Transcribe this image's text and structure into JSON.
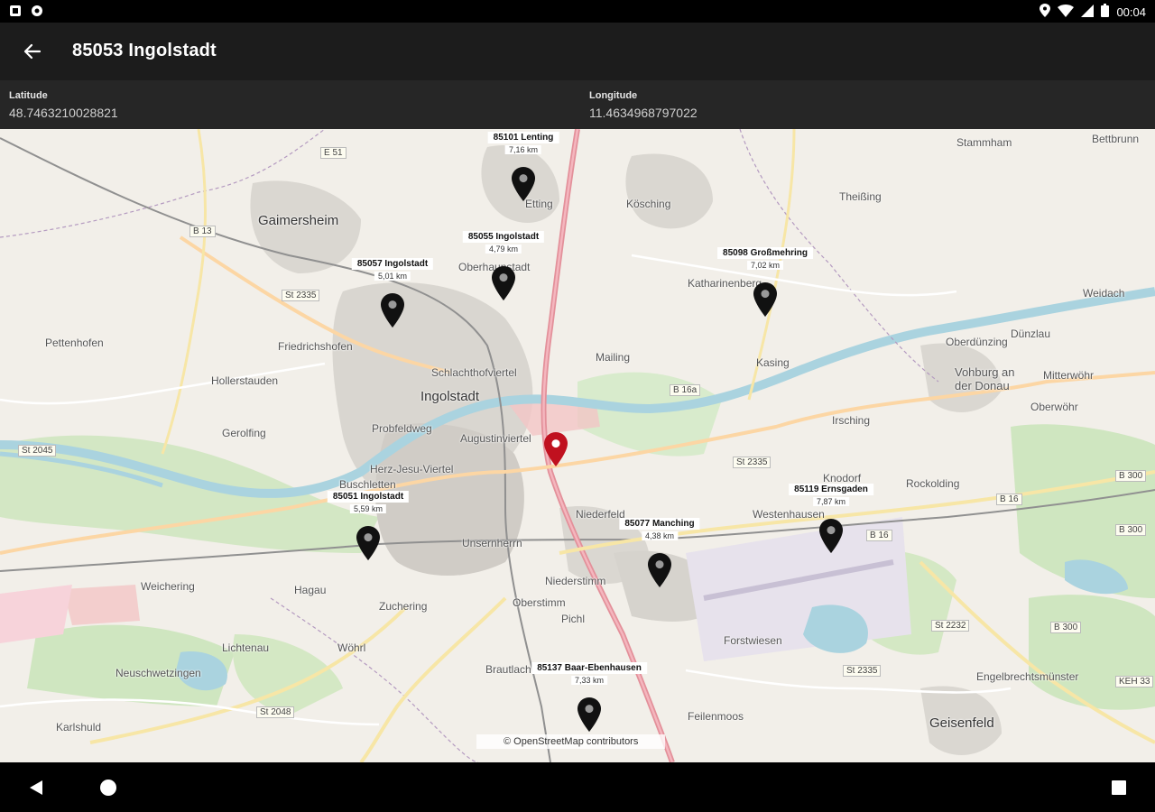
{
  "status_bar": {
    "time": "00:04",
    "left_icons": [
      "notification-icon",
      "sync-icon"
    ],
    "right_icons": [
      "location-icon",
      "wifi-icon",
      "signal-icon",
      "battery-icon"
    ]
  },
  "app_bar": {
    "title": "85053 Ingolstadt",
    "back_icon": "arrow-left-icon"
  },
  "coordinates": {
    "latitude_label": "Latitude",
    "latitude_value": "48.7463210028821",
    "longitude_label": "Longitude",
    "longitude_value": "11.4634968797022"
  },
  "map": {
    "attribution": "© OpenStreetMap contributors",
    "current_location": {
      "icon": "red-pin-icon",
      "color": "#c0111f"
    },
    "markers": [
      {
        "name": "85101 Lenting",
        "distance": "7,16 km"
      },
      {
        "name": "85055 Ingolstadt",
        "distance": "4,79 km"
      },
      {
        "name": "85057 Ingolstadt",
        "distance": "5,01 km"
      },
      {
        "name": "85098 Großmehring",
        "distance": "7,02 km"
      },
      {
        "name": "85051 Ingolstadt",
        "distance": "5,59 km"
      },
      {
        "name": "85077 Manching",
        "distance": "4,38 km"
      },
      {
        "name": "85119 Ernsgaden",
        "distance": "7,87 km"
      },
      {
        "name": "85137 Baar-Ebenhausen",
        "distance": "7,33 km"
      }
    ],
    "places": [
      {
        "name": "Ingolstadt"
      },
      {
        "name": "Gaimersheim"
      },
      {
        "name": "Etting"
      },
      {
        "name": "Friedrichshofen"
      },
      {
        "name": "Hollerstauden"
      },
      {
        "name": "Gerolfing"
      },
      {
        "name": "Probfeldweg"
      },
      {
        "name": "Schlachthofviertel"
      },
      {
        "name": "Augustinviertel"
      },
      {
        "name": "Herz-Jesu-Viertel"
      },
      {
        "name": "Buschletten"
      },
      {
        "name": "Unsernherrn"
      },
      {
        "name": "Niederfeld"
      },
      {
        "name": "Mailing"
      },
      {
        "name": "Kösching"
      },
      {
        "name": "Kasing"
      },
      {
        "name": "Katharinenberg"
      },
      {
        "name": "Theißing"
      },
      {
        "name": "Vohburg an der Donau"
      },
      {
        "name": "Oberdünzing"
      },
      {
        "name": "Irsching"
      },
      {
        "name": "Westenhausen"
      },
      {
        "name": "Knodorf"
      },
      {
        "name": "Oberhaunstadt"
      },
      {
        "name": "Zuchering"
      },
      {
        "name": "Hagau"
      },
      {
        "name": "Lichtenau"
      },
      {
        "name": "Weichering"
      },
      {
        "name": "Neuschwetzingen"
      },
      {
        "name": "Karlshuld"
      },
      {
        "name": "Wöhrl"
      },
      {
        "name": "Oberstimm"
      },
      {
        "name": "Niederstimm"
      },
      {
        "name": "Forstwiesen"
      },
      {
        "name": "Feilenmoos"
      },
      {
        "name": "Geisenfeld"
      },
      {
        "name": "Pichl"
      },
      {
        "name": "Brautlach"
      },
      {
        "name": "Rockolding"
      },
      {
        "name": "Dünzlau"
      },
      {
        "name": "Pettenhofen"
      },
      {
        "name": "Bettbrunn"
      },
      {
        "name": "Mitterwöhr"
      },
      {
        "name": "Oberwöhr"
      },
      {
        "name": "Engelbrechtsmünster"
      },
      {
        "name": "Weidach"
      },
      {
        "name": "Stammham"
      }
    ],
    "road_shields": [
      "E 51",
      "B 13",
      "St 2335",
      "St 2045",
      "B 16a",
      "St 2335",
      "B 16",
      "B 16",
      "B 300",
      "B 300",
      "St 2232",
      "B 300",
      "St 2335",
      "St 2048",
      "KEH 33"
    ]
  },
  "nav_bar": {
    "back_icon": "triangle-back-icon",
    "home_icon": "circle-home-icon",
    "recents_icon": "square-recents-icon"
  }
}
